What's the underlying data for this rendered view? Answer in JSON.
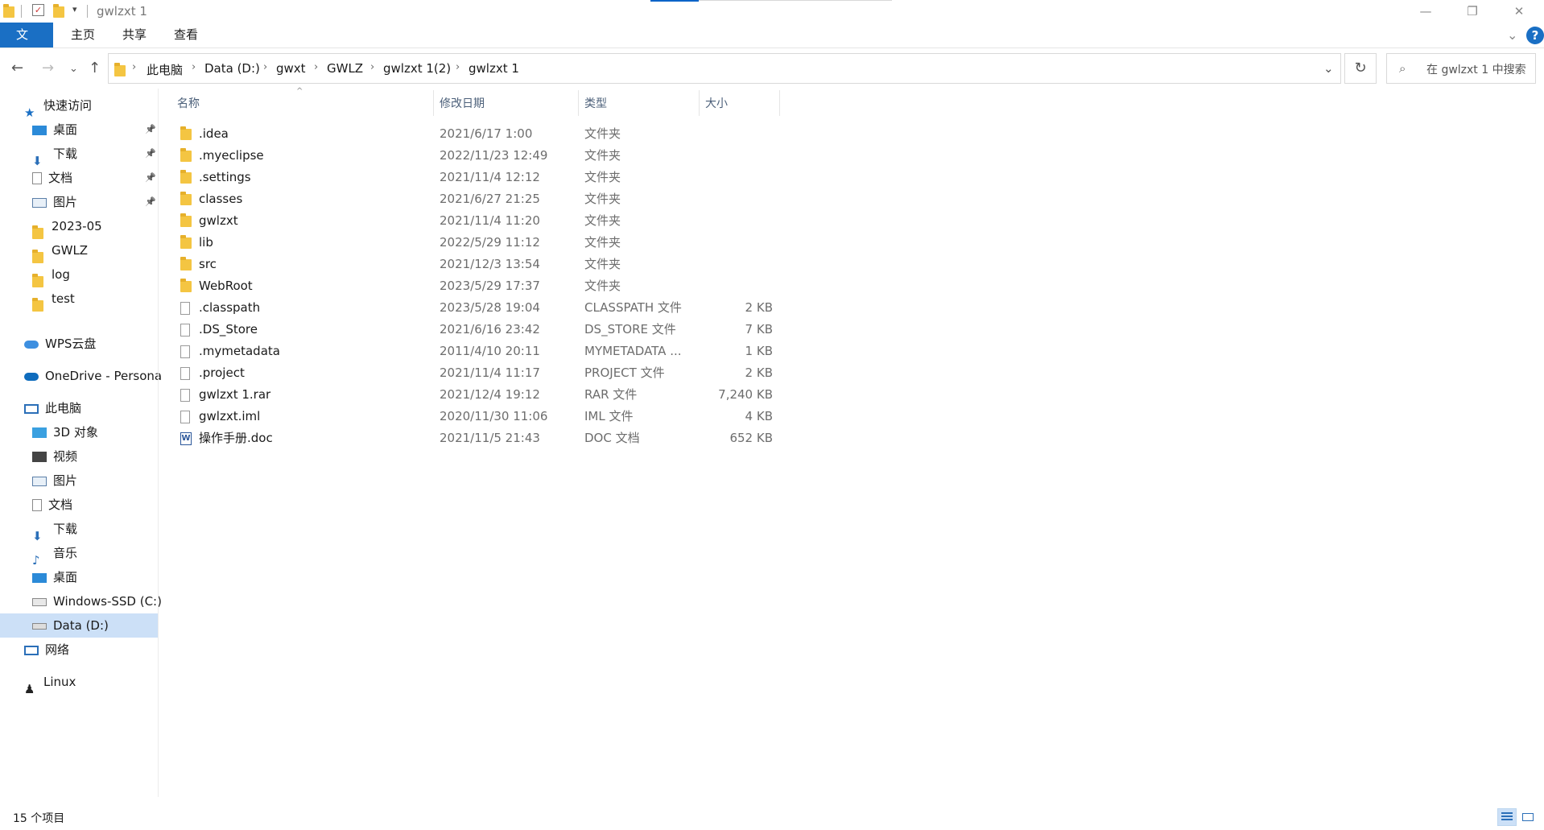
{
  "window": {
    "title": "gwlzxt 1",
    "minimize_glyph": "—",
    "restore_glyph": "❐",
    "close_glyph": "✕"
  },
  "ribbon": {
    "tabs": [
      "文件",
      "主页",
      "共享",
      "查看"
    ],
    "collapse_glyph": "⌄",
    "help_glyph": "?"
  },
  "address": {
    "crumbs": [
      "此电脑",
      "Data (D:)",
      "gwxt",
      "GWLZ",
      "gwlzxt 1(2)",
      "gwlzxt 1"
    ],
    "separator": "›",
    "dropdown_glyph": "⌄"
  },
  "search": {
    "placeholder": "在 gwlzxt 1 中搜索"
  },
  "sidebar": {
    "quick_access": "快速访问",
    "quick_items": [
      {
        "label": "桌面",
        "icon": "desktop-icon",
        "pinned": true
      },
      {
        "label": "下载",
        "icon": "download-icon",
        "pinned": true
      },
      {
        "label": "文档",
        "icon": "document-icon",
        "pinned": true
      },
      {
        "label": "图片",
        "icon": "pictures-icon",
        "pinned": true
      },
      {
        "label": "2023-05",
        "icon": "folder-icon",
        "pinned": false
      },
      {
        "label": "GWLZ",
        "icon": "folder-icon",
        "pinned": false
      },
      {
        "label": "log",
        "icon": "folder-icon",
        "pinned": false
      },
      {
        "label": "test",
        "icon": "folder-icon",
        "pinned": false
      }
    ],
    "wps": "WPS云盘",
    "onedrive": "OneDrive - Persona",
    "this_pc": "此电脑",
    "pc_items": [
      {
        "label": "3D 对象",
        "icon": "3d-objects-icon"
      },
      {
        "label": "视频",
        "icon": "videos-icon"
      },
      {
        "label": "图片",
        "icon": "pictures-icon"
      },
      {
        "label": "文档",
        "icon": "document-icon"
      },
      {
        "label": "下载",
        "icon": "download-icon"
      },
      {
        "label": "音乐",
        "icon": "music-icon"
      },
      {
        "label": "桌面",
        "icon": "desktop-icon"
      },
      {
        "label": "Windows-SSD (C:)",
        "icon": "drive-c-icon"
      },
      {
        "label": "Data (D:)",
        "icon": "drive-d-icon",
        "selected": true
      }
    ],
    "network": "网络",
    "linux": "Linux"
  },
  "columns": {
    "name": "名称",
    "date": "修改日期",
    "type": "类型",
    "size": "大小"
  },
  "files": [
    {
      "name": ".idea",
      "date": "2021/6/17 1:00",
      "type": "文件夹",
      "size": "",
      "kind": "folder"
    },
    {
      "name": ".myeclipse",
      "date": "2022/11/23 12:49",
      "type": "文件夹",
      "size": "",
      "kind": "folder"
    },
    {
      "name": ".settings",
      "date": "2021/11/4 12:12",
      "type": "文件夹",
      "size": "",
      "kind": "folder"
    },
    {
      "name": "classes",
      "date": "2021/6/27 21:25",
      "type": "文件夹",
      "size": "",
      "kind": "folder"
    },
    {
      "name": "gwlzxt",
      "date": "2021/11/4 11:20",
      "type": "文件夹",
      "size": "",
      "kind": "folder"
    },
    {
      "name": "lib",
      "date": "2022/5/29 11:12",
      "type": "文件夹",
      "size": "",
      "kind": "folder"
    },
    {
      "name": "src",
      "date": "2021/12/3 13:54",
      "type": "文件夹",
      "size": "",
      "kind": "folder"
    },
    {
      "name": "WebRoot",
      "date": "2023/5/29 17:37",
      "type": "文件夹",
      "size": "",
      "kind": "folder"
    },
    {
      "name": ".classpath",
      "date": "2023/5/28 19:04",
      "type": "CLASSPATH 文件",
      "size": "2 KB",
      "kind": "file"
    },
    {
      "name": ".DS_Store",
      "date": "2021/6/16 23:42",
      "type": "DS_STORE 文件",
      "size": "7 KB",
      "kind": "file"
    },
    {
      "name": ".mymetadata",
      "date": "2011/4/10 20:11",
      "type": "MYMETADATA ...",
      "size": "1 KB",
      "kind": "file"
    },
    {
      "name": ".project",
      "date": "2021/11/4 11:17",
      "type": "PROJECT 文件",
      "size": "2 KB",
      "kind": "file"
    },
    {
      "name": "gwlzxt 1.rar",
      "date": "2021/12/4 19:12",
      "type": "RAR 文件",
      "size": "7,240 KB",
      "kind": "file"
    },
    {
      "name": "gwlzxt.iml",
      "date": "2020/11/30 11:06",
      "type": "IML 文件",
      "size": "4 KB",
      "kind": "file"
    },
    {
      "name": "操作手册.doc",
      "date": "2021/11/5 21:43",
      "type": "DOC 文档",
      "size": "652 KB",
      "kind": "doc"
    }
  ],
  "status": {
    "count": "15 个项目"
  },
  "colors": {
    "accent": "#1a6fc4",
    "selection": "#cce0f7",
    "folder": "#f4c542"
  }
}
